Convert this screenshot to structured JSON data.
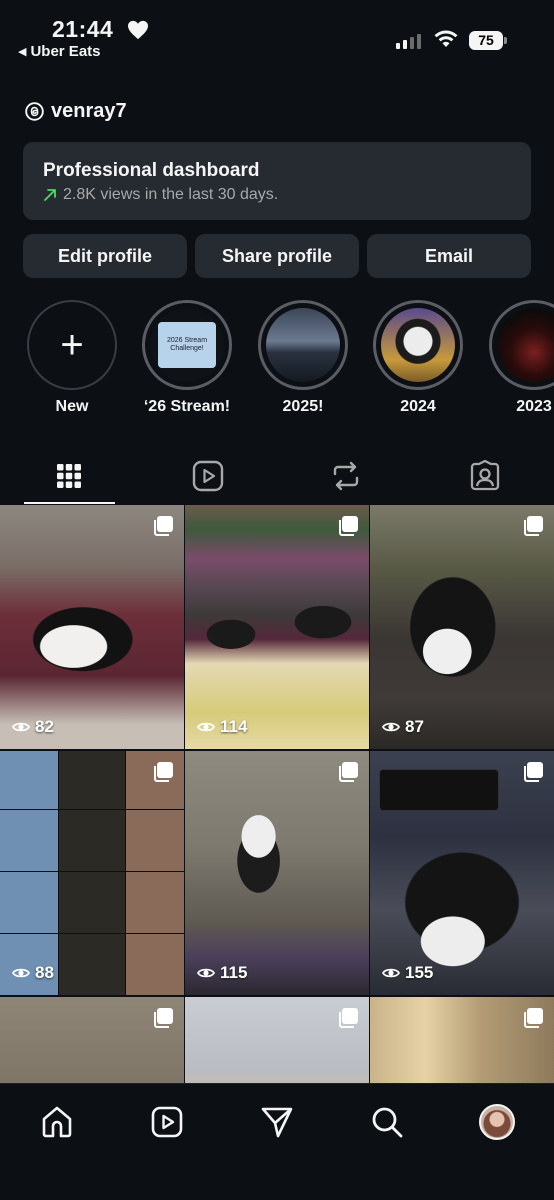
{
  "status_bar": {
    "time": "21:44",
    "back_app": "Uber Eats",
    "battery": "75"
  },
  "profile": {
    "username": "venray7"
  },
  "dashboard": {
    "title": "Professional dashboard",
    "subtitle": "2.8K views in the last 30 days.",
    "trend_icon": "trend-up-arrow",
    "accent": "#4cd964"
  },
  "buttons": {
    "edit": "Edit profile",
    "share": "Share profile",
    "email": "Email"
  },
  "highlights": [
    {
      "label": "New",
      "type": "new"
    },
    {
      "label": "‘26 Stream!",
      "cover_text": "2026 Stream Challenge!"
    },
    {
      "label": "2025!"
    },
    {
      "label": "2024"
    },
    {
      "label": "2023"
    }
  ],
  "tabs": [
    {
      "name": "grid-icon",
      "active": true
    },
    {
      "name": "reels-icon",
      "active": false
    },
    {
      "name": "reposts-icon",
      "active": false
    },
    {
      "name": "tagged-icon",
      "active": false
    }
  ],
  "posts": [
    {
      "views": "82",
      "multi": true
    },
    {
      "views": "114",
      "multi": true
    },
    {
      "views": "87",
      "multi": true
    },
    {
      "views": "88",
      "multi": true
    },
    {
      "views": "115",
      "multi": true
    },
    {
      "views": "155",
      "multi": true
    },
    {
      "views": "",
      "multi": true
    },
    {
      "views": "",
      "multi": true
    },
    {
      "views": "",
      "multi": true
    }
  ],
  "nav": [
    "home-icon",
    "reels-icon",
    "send-icon",
    "search-icon",
    "profile-avatar"
  ],
  "colors": {
    "background": "#0c1014",
    "card": "#262a31",
    "text": "#f5f5f5",
    "muted": "#a8a8a8"
  }
}
